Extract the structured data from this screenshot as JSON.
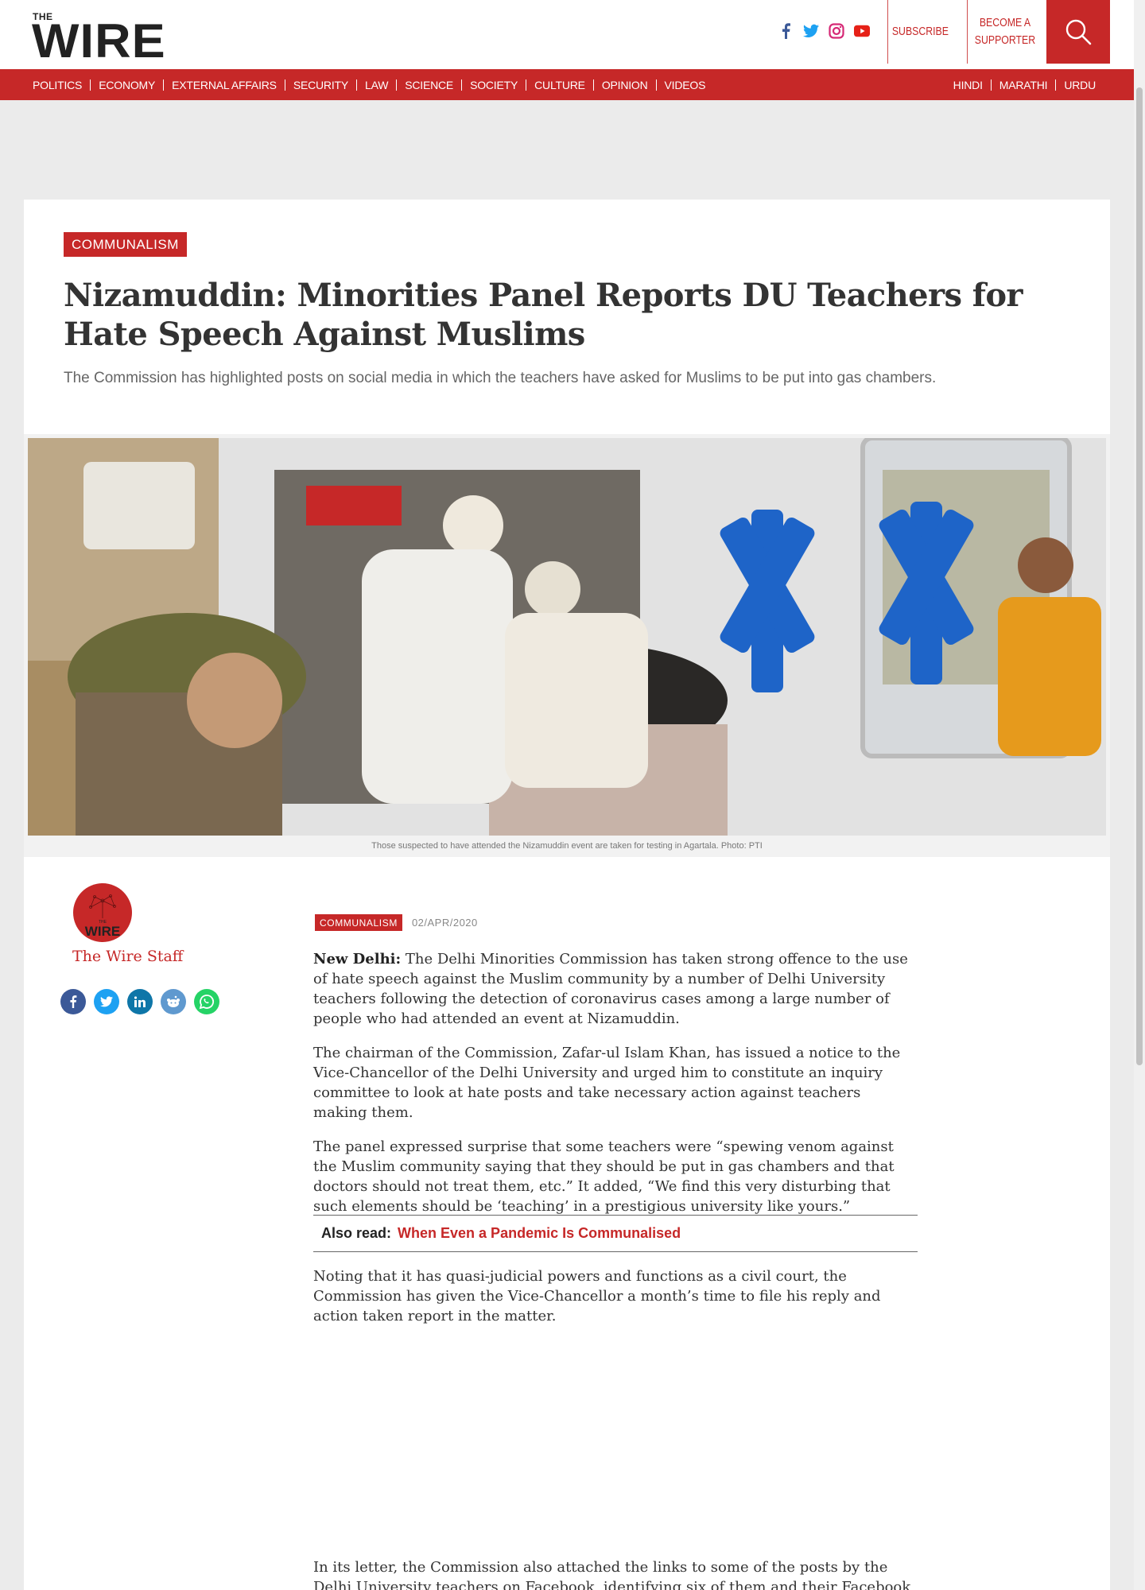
{
  "header": {
    "logo_small": "THE",
    "logo_big": "WIRE",
    "subscribe": "SUBSCRIBE",
    "supporter_line1": "BECOME A",
    "supporter_line2": "SUPPORTER",
    "social_icons": [
      "facebook-icon",
      "twitter-icon",
      "instagram-icon",
      "youtube-icon"
    ]
  },
  "nav": {
    "left": [
      "POLITICS",
      "ECONOMY",
      "EXTERNAL AFFAIRS",
      "SECURITY",
      "LAW",
      "SCIENCE",
      "SOCIETY",
      "CULTURE",
      "OPINION",
      "VIDEOS"
    ],
    "right": [
      "HINDI",
      "MARATHI",
      "URDU"
    ]
  },
  "article": {
    "category": "COMMUNALISM",
    "title": "Nizamuddin: Minorities Panel Reports DU Teachers for Hate Speech Against Muslims",
    "subtitle": "The Commission has highlighted posts on social media in which the teachers have asked for Muslims to be put into gas chambers.",
    "caption": "Those suspected to have attended the Nizamuddin event are taken for testing in Agartala. Photo: PTI",
    "author": "The Wire Staff",
    "date": "02/APR/2020",
    "dateline": "New Delhi:",
    "p1": "The Delhi Minorities Commission has taken strong offence to the use of hate speech against the Muslim community by a number of Delhi University teachers following the detection of coronavirus cases among a large number of people who had attended an event at Nizamuddin.",
    "p2": "The chairman of the Commission, Zafar-ul Islam Khan, has issued a notice to the Vice-Chancellor of the Delhi University and urged him to constitute an inquiry committee to look at hate posts and take necessary action against teachers making them.",
    "p3": "The panel expressed surprise that some teachers were “spewing venom against the Muslim community saying that they should be put in gas chambers and that doctors should not treat them, etc.” It added, “We find this very disturbing that such elements should be ‘teaching’ in a prestigious university like yours.”",
    "also_read_label": "Also read:",
    "also_read_link": "When Even a Pandemic Is Communalised",
    "p4": "Noting that it has quasi-judicial powers and functions as a civil court, the Commission has given the Vice-Chancellor a month’s time to file his reply and action taken report in the matter.",
    "p5": "In its letter, the Commission also attached the links to some of the posts by the Delhi University teachers on Facebook, identifying six of them and their Facebook profiles."
  },
  "share_icons": [
    "facebook-share-icon",
    "twitter-share-icon",
    "linkedin-share-icon",
    "reddit-share-icon",
    "whatsapp-share-icon"
  ],
  "colors": {
    "brand_red": "#c62828",
    "facebook": "#3b5998",
    "twitter": "#1da1f2",
    "linkedin": "#0e76a8",
    "reddit": "#5f99cf",
    "whatsapp": "#25d366"
  }
}
